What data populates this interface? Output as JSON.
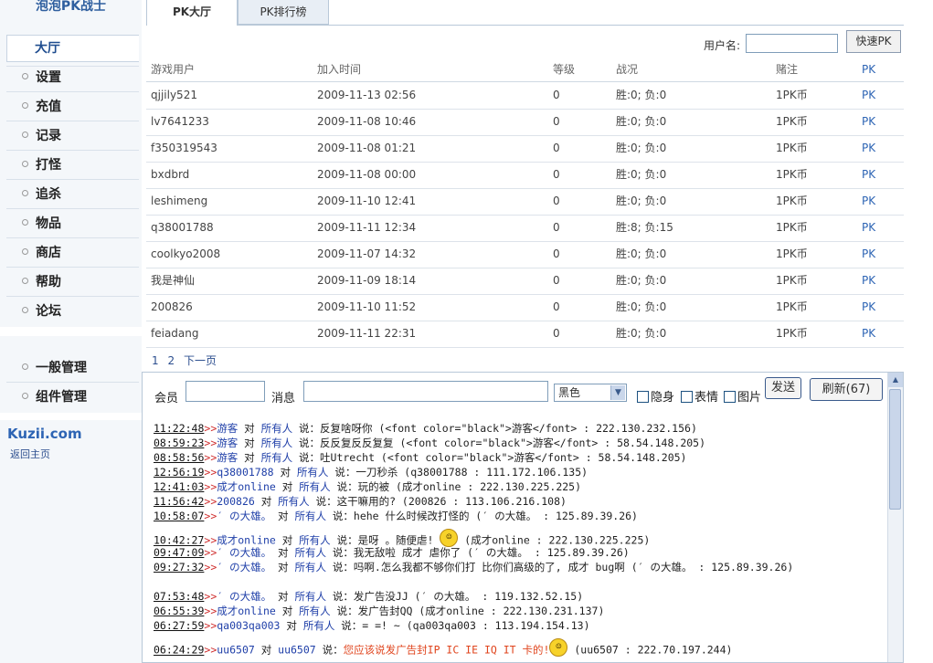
{
  "app": {
    "logo": "泡泡PK战士",
    "site": "Kuzii.com",
    "home_link": "返回主页"
  },
  "sidebar": {
    "active": "大厅",
    "items": [
      {
        "label": "设置"
      },
      {
        "label": "充值"
      },
      {
        "label": "记录"
      },
      {
        "label": "打怪"
      },
      {
        "label": "追杀"
      },
      {
        "label": "物品"
      },
      {
        "label": "商店"
      },
      {
        "label": "帮助"
      },
      {
        "label": "论坛"
      }
    ],
    "admin_items": [
      {
        "label": "一般管理"
      },
      {
        "label": "组件管理"
      }
    ]
  },
  "tabs": [
    {
      "label": "PK大厅",
      "active": true
    },
    {
      "label": "PK排行榜",
      "active": false
    }
  ],
  "search": {
    "label": "用户名:",
    "value": "",
    "button": "快速PK"
  },
  "table": {
    "headers": [
      "游戏用户",
      "加入时间",
      "等级",
      "战况",
      "赌注",
      "PK"
    ],
    "rows": [
      [
        "qjjily521",
        "2009-11-13 02:56",
        "0",
        "胜:0;  负:0",
        "1PK币",
        "PK"
      ],
      [
        "lv7641233",
        "2009-11-08 10:46",
        "0",
        "胜:0;  负:0",
        "1PK币",
        "PK"
      ],
      [
        "f350319543",
        "2009-11-08 01:21",
        "0",
        "胜:0;  负:0",
        "1PK币",
        "PK"
      ],
      [
        "bxdbrd",
        "2009-11-08 00:00",
        "0",
        "胜:0;  负:0",
        "1PK币",
        "PK"
      ],
      [
        "leshimeng",
        "2009-11-10 12:41",
        "0",
        "胜:0;  负:0",
        "1PK币",
        "PK"
      ],
      [
        "q38001788",
        "2009-11-11 12:34",
        "0",
        "胜:8;  负:15",
        "1PK币",
        "PK"
      ],
      [
        "coolkyo2008",
        "2009-11-07 14:32",
        "0",
        "胜:0;  负:0",
        "1PK币",
        "PK"
      ],
      [
        "我是神仙",
        "2009-11-09 18:14",
        "0",
        "胜:0;  负:0",
        "1PK币",
        "PK"
      ],
      [
        "200826",
        "2009-11-10 11:52",
        "0",
        "胜:0;  负:0",
        "1PK币",
        "PK"
      ],
      [
        "feiadang",
        "2009-11-11 22:31",
        "0",
        "胜:0;  负:0",
        "1PK币",
        "PK"
      ]
    ]
  },
  "pager": {
    "pages": [
      "1",
      "2"
    ],
    "next": "下一页"
  },
  "chat": {
    "member_label": "会员",
    "message_label": "消息",
    "color_value": "黑色",
    "checkboxes": [
      "隐身",
      "表情",
      "图片"
    ],
    "send": "发送",
    "refresh": "刷新(67)",
    "messages": [
      {
        "time": "11:22:48",
        "user": "游客",
        "mid": " 对 ",
        "target": "所有人",
        "say": " 说：反复啥呀你 (<font color=\"black\">游客</font> : 222.130.232.156)"
      },
      {
        "time": "08:59:23",
        "user": "游客",
        "mid": " 对 ",
        "target": "所有人",
        "say": " 说：反反复反反复复 (<font color=\"black\">游客</font> : 58.54.148.205)"
      },
      {
        "time": "08:58:56",
        "user": "游客",
        "mid": " 对 ",
        "target": "所有人",
        "say": " 说：吐Utrecht (<font color=\"black\">游客</font> : 58.54.148.205)"
      },
      {
        "time": "12:56:19",
        "user": "q38001788",
        "mid": " 对 ",
        "target": "所有人",
        "say": " 说：一刀秒杀 (q38001788 : 111.172.106.135)"
      },
      {
        "time": "12:41:03",
        "user": "成才online",
        "mid": " 对 ",
        "target": "所有人",
        "say": " 说：玩的被 (成才online : 222.130.225.225)"
      },
      {
        "time": "11:56:42",
        "user": "200826",
        "mid": " 对 ",
        "target": "所有人",
        "say": " 说：这干嘛用的? (200826 : 113.106.216.108)"
      },
      {
        "time": "10:58:07",
        "user": "′ の大雄。",
        "mid": " 对 ",
        "target": "所有人",
        "say": " 说：hehe 什么时候改打怪的 (′ の大雄。 : 125.89.39.26)"
      },
      {
        "time": "10:42:27",
        "user": "成才online",
        "mid": " 对 ",
        "target": "所有人",
        "say_a": " 说：是呀 。随便虐! ",
        "say": " (成才online : 222.130.225.225)"
      },
      {
        "time": "09:47:09",
        "user": "′ の大雄。",
        "mid": " 对 ",
        "target": "所有人",
        "say": " 说：我无敌啦 成才 虐你了 (′ の大雄。 : 125.89.39.26)"
      },
      {
        "time": "09:27:32",
        "user": "′ の大雄。",
        "mid": " 对 ",
        "target": "所有人",
        "say": " 说：吗啊.怎么我都不够你们打 比你们高级的了, 成才 bug啊 (′ の大雄。 : 125.89.39.26)"
      },
      {
        "time": "07:53:48",
        "user": "′ の大雄。",
        "mid": " 对 ",
        "target": "所有人",
        "say": " 说：发广告没JJ (′ の大雄。 : 119.132.52.15)"
      },
      {
        "time": "06:55:39",
        "user": "成才online",
        "mid": " 对 ",
        "target": "所有人",
        "say": " 说：发广告封QQ (成才online : 222.130.231.137)"
      },
      {
        "time": "06:27:59",
        "user": "qa003qa003",
        "mid": " 对 ",
        "target": "所有人",
        "say": " 说：= =! ~ (qa003qa003 : 113.194.154.13)"
      },
      {
        "time": "06:24:29",
        "user": "uu6507",
        "mid": " 对 ",
        "target": "uu6507",
        "say_a": " 说：",
        "say_red": "您应该说发广告封IP IC IE IQ IT 卡的!",
        "say": " (uu6507 : 222.70.197.244)"
      }
    ]
  }
}
